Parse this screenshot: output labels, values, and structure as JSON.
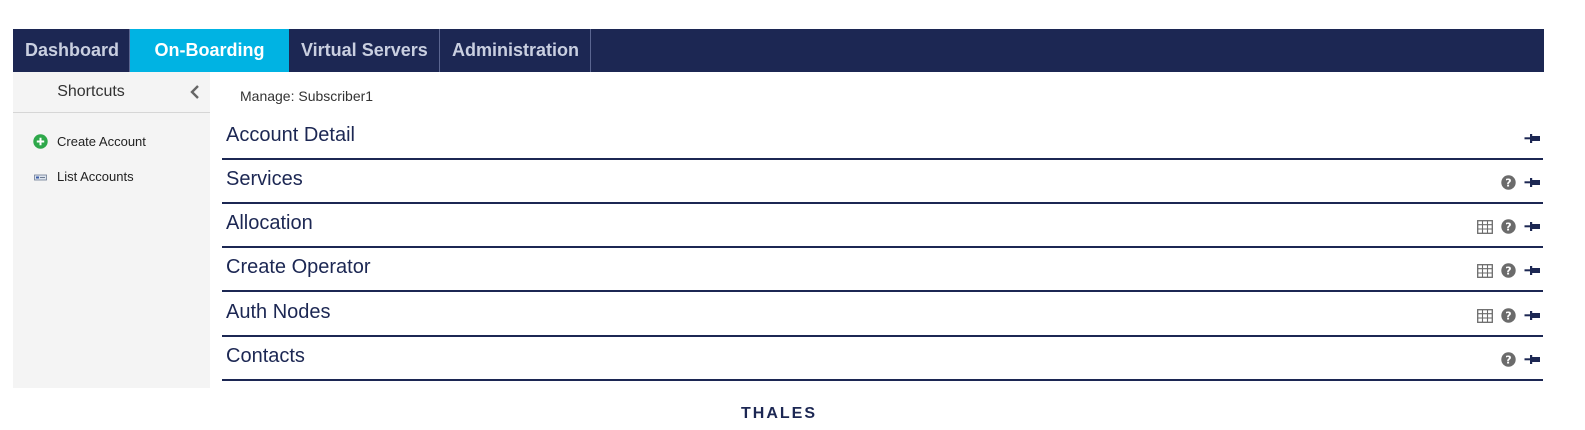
{
  "nav": {
    "tabs": [
      {
        "label": "Dashboard",
        "active": false
      },
      {
        "label": "On-Boarding",
        "active": true
      },
      {
        "label": "Virtual Servers",
        "active": false
      },
      {
        "label": "Administration",
        "active": false
      }
    ]
  },
  "sidebar": {
    "title": "Shortcuts",
    "items": [
      {
        "label": "Create Account",
        "icon": "plus-circle-icon"
      },
      {
        "label": "List Accounts",
        "icon": "list-card-icon"
      }
    ]
  },
  "breadcrumb": "Manage: Subscriber1",
  "sections": [
    {
      "title": "Account Detail",
      "icons": [
        "pin-icon"
      ]
    },
    {
      "title": "Services",
      "icons": [
        "help-icon",
        "pin-icon"
      ]
    },
    {
      "title": "Allocation",
      "icons": [
        "table-icon",
        "help-icon",
        "pin-icon"
      ]
    },
    {
      "title": "Create Operator",
      "icons": [
        "table-icon",
        "help-icon",
        "pin-icon"
      ]
    },
    {
      "title": "Auth Nodes",
      "icons": [
        "table-icon",
        "help-icon",
        "pin-icon"
      ]
    },
    {
      "title": "Contacts",
      "icons": [
        "help-icon",
        "pin-icon"
      ]
    }
  ],
  "footer": {
    "logo": "THALES"
  },
  "colors": {
    "navy": "#1c2753",
    "accent": "#00b3e3",
    "plus_green": "#2ea84a"
  }
}
